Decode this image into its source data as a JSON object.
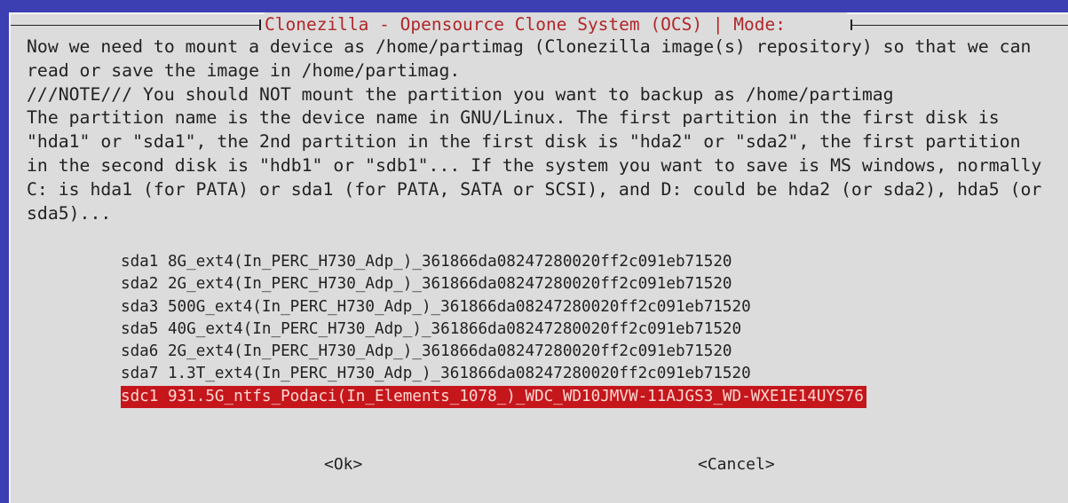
{
  "dialog": {
    "title": "Clonezilla - Opensource Clone System (OCS) | Mode:",
    "note_lines": [
      "Now we need to mount a device as /home/partimag (Clonezilla image(s) repository) so that we can",
      "read or save the image in /home/partimag.",
      "///NOTE/// You should NOT mount the partition you want to backup as /home/partimag",
      "The partition name is the device name in GNU/Linux. The first partition in the first disk is",
      "\"hda1\" or \"sda1\", the 2nd partition in the first disk is \"hda2\" or \"sda2\", the first partition",
      "in the second disk is \"hdb1\" or \"sdb1\"... If the system you want to save is MS windows, normally",
      "C: is hda1 (for PATA) or sda1 (for PATA, SATA or SCSI), and D: could be hda2 (or sda2), hda5 (or",
      "sda5)..."
    ],
    "devices": [
      "sda1 8G_ext4(In_PERC_H730_Adp_)_361866da08247280020ff2c091eb71520",
      "sda2 2G_ext4(In_PERC_H730_Adp_)_361866da08247280020ff2c091eb71520",
      "sda3 500G_ext4(In_PERC_H730_Adp_)_361866da08247280020ff2c091eb71520",
      "sda5 40G_ext4(In_PERC_H730_Adp_)_361866da08247280020ff2c091eb71520",
      "sda6 2G_ext4(In_PERC_H730_Adp_)_361866da08247280020ff2c091eb71520",
      "sda7 1.3T_ext4(In_PERC_H730_Adp_)_361866da08247280020ff2c091eb71520",
      "sdc1 931.5G_ntfs_Podaci(In_Elements_1078_)_WDC_WD10JMVW-11AJGS3_WD-WXE1E14UYS76"
    ],
    "selected_index": 6,
    "ok_label": "<Ok>",
    "cancel_label": "<Cancel>"
  },
  "colors": {
    "background": "#3b3fb2",
    "dialog": "#dcdcdc",
    "title_text": "#b0272a",
    "selection": "#c5161c"
  }
}
